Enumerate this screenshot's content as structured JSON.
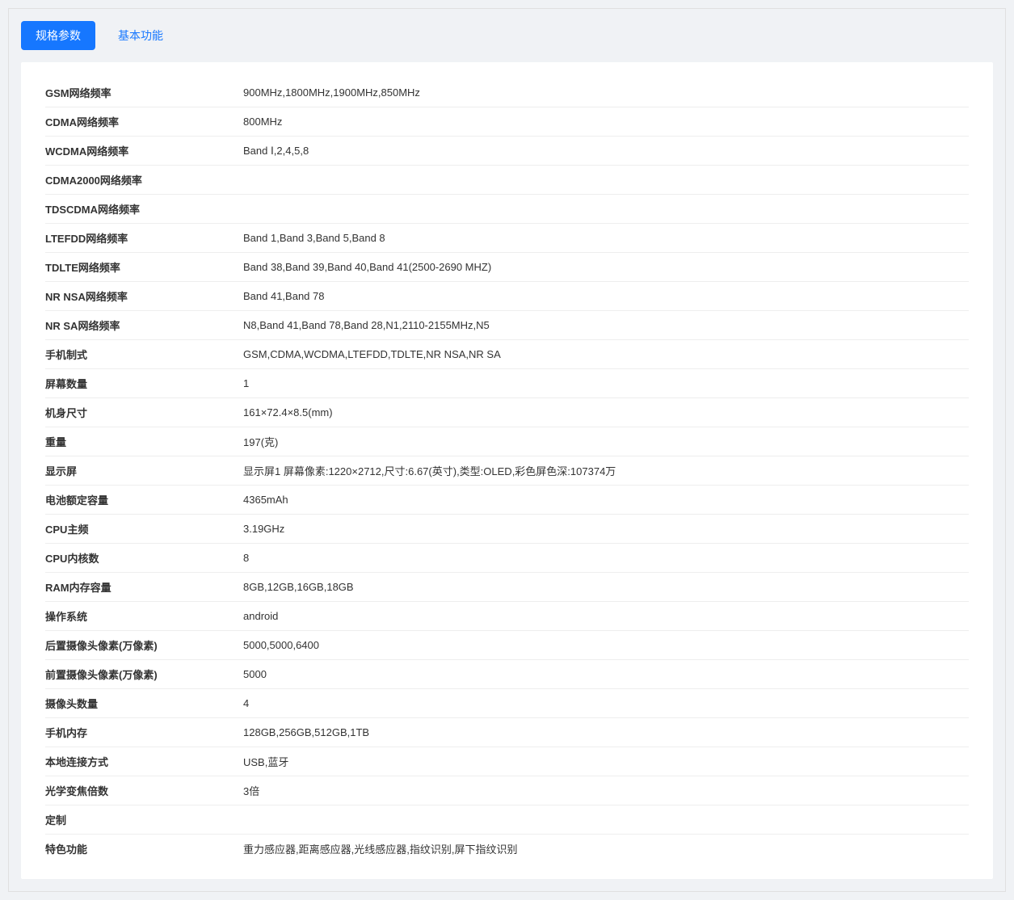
{
  "tabs": {
    "active": "规格参数",
    "inactive": "基本功能"
  },
  "specs": [
    {
      "label": "GSM网络频率",
      "value": "900MHz,1800MHz,1900MHz,850MHz"
    },
    {
      "label": "CDMA网络频率",
      "value": "800MHz"
    },
    {
      "label": "WCDMA网络频率",
      "value": "Band Ⅰ,2,4,5,8"
    },
    {
      "label": "CDMA2000网络频率",
      "value": ""
    },
    {
      "label": "TDSCDMA网络频率",
      "value": ""
    },
    {
      "label": "LTEFDD网络频率",
      "value": "Band 1,Band 3,Band 5,Band 8"
    },
    {
      "label": "TDLTE网络频率",
      "value": "Band 38,Band 39,Band 40,Band 41(2500-2690 MHZ)"
    },
    {
      "label": "NR NSA网络频率",
      "value": "Band 41,Band 78"
    },
    {
      "label": "NR SA网络频率",
      "value": "N8,Band 41,Band 78,Band 28,N1,2110-2155MHz,N5"
    },
    {
      "label": "手机制式",
      "value": "GSM,CDMA,WCDMA,LTEFDD,TDLTE,NR NSA,NR SA"
    },
    {
      "label": "屏幕数量",
      "value": "1"
    },
    {
      "label": "机身尺寸",
      "value": "161×72.4×8.5(mm)"
    },
    {
      "label": "重量",
      "value": "197(克)"
    },
    {
      "label": "显示屏",
      "value": "显示屏1 屏幕像素:1220×2712,尺寸:6.67(英寸),类型:OLED,彩色屏色深:107374万"
    },
    {
      "label": "电池额定容量",
      "value": "4365mAh"
    },
    {
      "label": "CPU主频",
      "value": "3.19GHz"
    },
    {
      "label": "CPU内核数",
      "value": "8"
    },
    {
      "label": "RAM内存容量",
      "value": "8GB,12GB,16GB,18GB"
    },
    {
      "label": "操作系统",
      "value": "android"
    },
    {
      "label": "后置摄像头像素(万像素)",
      "value": "5000,5000,6400"
    },
    {
      "label": "前置摄像头像素(万像素)",
      "value": "5000"
    },
    {
      "label": "摄像头数量",
      "value": "4"
    },
    {
      "label": "手机内存",
      "value": "128GB,256GB,512GB,1TB"
    },
    {
      "label": "本地连接方式",
      "value": "USB,蓝牙"
    },
    {
      "label": "光学变焦倍数",
      "value": "3倍"
    },
    {
      "label": "定制",
      "value": ""
    },
    {
      "label": "特色功能",
      "value": "重力感应器,距离感应器,光线感应器,指纹识别,屏下指纹识别"
    }
  ]
}
